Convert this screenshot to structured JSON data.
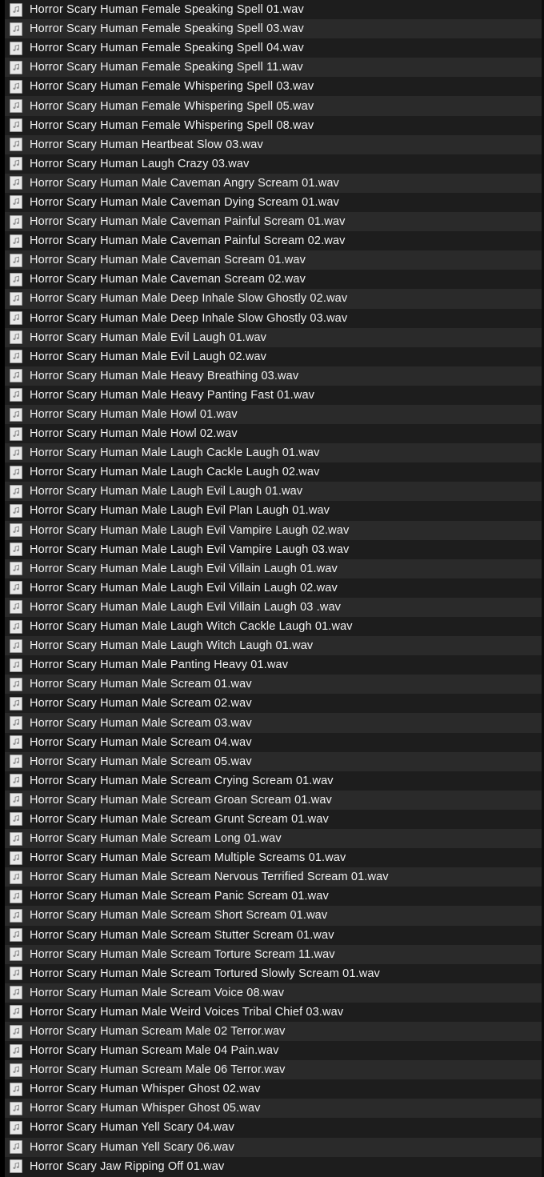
{
  "window": {
    "view_mode": "list",
    "background_color": "#1d1d1d",
    "row_alt_color": "#2a2a2a",
    "text_color": "#f2f2f2",
    "icon_name": "audio-file-icon",
    "icon_glyph": "music-note"
  },
  "file_list": {
    "count": 61,
    "items": [
      {
        "name": "Horror Scary Human Female Speaking Spell 01.wav"
      },
      {
        "name": "Horror Scary Human Female Speaking Spell 03.wav"
      },
      {
        "name": "Horror Scary Human Female Speaking Spell 04.wav"
      },
      {
        "name": "Horror Scary Human Female Speaking Spell 11.wav"
      },
      {
        "name": "Horror Scary Human Female Whispering Spell 03.wav"
      },
      {
        "name": "Horror Scary Human Female Whispering Spell 05.wav"
      },
      {
        "name": "Horror Scary Human Female Whispering Spell 08.wav"
      },
      {
        "name": "Horror Scary Human Heartbeat Slow 03.wav"
      },
      {
        "name": "Horror Scary Human Laugh Crazy 03.wav"
      },
      {
        "name": "Horror Scary Human Male Caveman Angry Scream 01.wav"
      },
      {
        "name": "Horror Scary Human Male Caveman Dying Scream 01.wav"
      },
      {
        "name": "Horror Scary Human Male Caveman Painful Scream 01.wav"
      },
      {
        "name": "Horror Scary Human Male Caveman Painful Scream 02.wav"
      },
      {
        "name": "Horror Scary Human Male Caveman Scream 01.wav"
      },
      {
        "name": "Horror Scary Human Male Caveman Scream 02.wav"
      },
      {
        "name": "Horror Scary Human Male Deep Inhale Slow Ghostly 02.wav"
      },
      {
        "name": "Horror Scary Human Male Deep Inhale Slow Ghostly 03.wav"
      },
      {
        "name": "Horror Scary Human Male Evil Laugh 01.wav"
      },
      {
        "name": "Horror Scary Human Male Evil Laugh 02.wav"
      },
      {
        "name": "Horror Scary Human Male Heavy Breathing 03.wav"
      },
      {
        "name": "Horror Scary Human Male Heavy Panting Fast 01.wav"
      },
      {
        "name": "Horror Scary Human Male Howl 01.wav"
      },
      {
        "name": "Horror Scary Human Male Howl 02.wav"
      },
      {
        "name": "Horror Scary Human Male Laugh Cackle Laugh 01.wav"
      },
      {
        "name": "Horror Scary Human Male Laugh Cackle Laugh 02.wav"
      },
      {
        "name": "Horror Scary Human Male Laugh Evil Laugh 01.wav"
      },
      {
        "name": "Horror Scary Human Male Laugh Evil Plan Laugh 01.wav"
      },
      {
        "name": "Horror Scary Human Male Laugh Evil Vampire Laugh 02.wav"
      },
      {
        "name": "Horror Scary Human Male Laugh Evil Vampire Laugh 03.wav"
      },
      {
        "name": "Horror Scary Human Male Laugh Evil Villain Laugh 01.wav"
      },
      {
        "name": "Horror Scary Human Male Laugh Evil Villain Laugh 02.wav"
      },
      {
        "name": "Horror Scary Human Male Laugh Evil Villain Laugh 03 .wav"
      },
      {
        "name": "Horror Scary Human Male Laugh Witch Cackle Laugh 01.wav"
      },
      {
        "name": "Horror Scary Human Male Laugh Witch Laugh 01.wav"
      },
      {
        "name": "Horror Scary Human Male Panting Heavy 01.wav"
      },
      {
        "name": "Horror Scary Human Male Scream 01.wav"
      },
      {
        "name": "Horror Scary Human Male Scream 02.wav"
      },
      {
        "name": "Horror Scary Human Male Scream 03.wav"
      },
      {
        "name": "Horror Scary Human Male Scream 04.wav"
      },
      {
        "name": "Horror Scary Human Male Scream 05.wav"
      },
      {
        "name": "Horror Scary Human Male Scream Crying Scream 01.wav"
      },
      {
        "name": "Horror Scary Human Male Scream Groan Scream 01.wav"
      },
      {
        "name": "Horror Scary Human Male Scream Grunt Scream 01.wav"
      },
      {
        "name": "Horror Scary Human Male Scream Long 01.wav"
      },
      {
        "name": "Horror Scary Human Male Scream Multiple Screams 01.wav"
      },
      {
        "name": "Horror Scary Human Male Scream Nervous Terrified Scream 01.wav"
      },
      {
        "name": "Horror Scary Human Male Scream Panic Scream 01.wav"
      },
      {
        "name": "Horror Scary Human Male Scream Short Scream 01.wav"
      },
      {
        "name": "Horror Scary Human Male Scream Stutter Scream 01.wav"
      },
      {
        "name": "Horror Scary Human Male Scream Torture Scream 11.wav"
      },
      {
        "name": "Horror Scary Human Male Scream Tortured Slowly Scream 01.wav"
      },
      {
        "name": "Horror Scary Human Male Scream Voice 08.wav"
      },
      {
        "name": "Horror Scary Human Male Weird Voices Tribal Chief 03.wav"
      },
      {
        "name": "Horror Scary Human Scream Male 02 Terror.wav"
      },
      {
        "name": "Horror Scary Human Scream Male 04 Pain.wav"
      },
      {
        "name": "Horror Scary Human Scream Male 06 Terror.wav"
      },
      {
        "name": "Horror Scary Human Whisper Ghost 02.wav"
      },
      {
        "name": "Horror Scary Human Whisper Ghost 05.wav"
      },
      {
        "name": "Horror Scary Human Yell Scary 04.wav"
      },
      {
        "name": "Horror Scary Human Yell Scary 06.wav"
      },
      {
        "name": "Horror Scary Jaw Ripping Off 01.wav"
      }
    ]
  }
}
